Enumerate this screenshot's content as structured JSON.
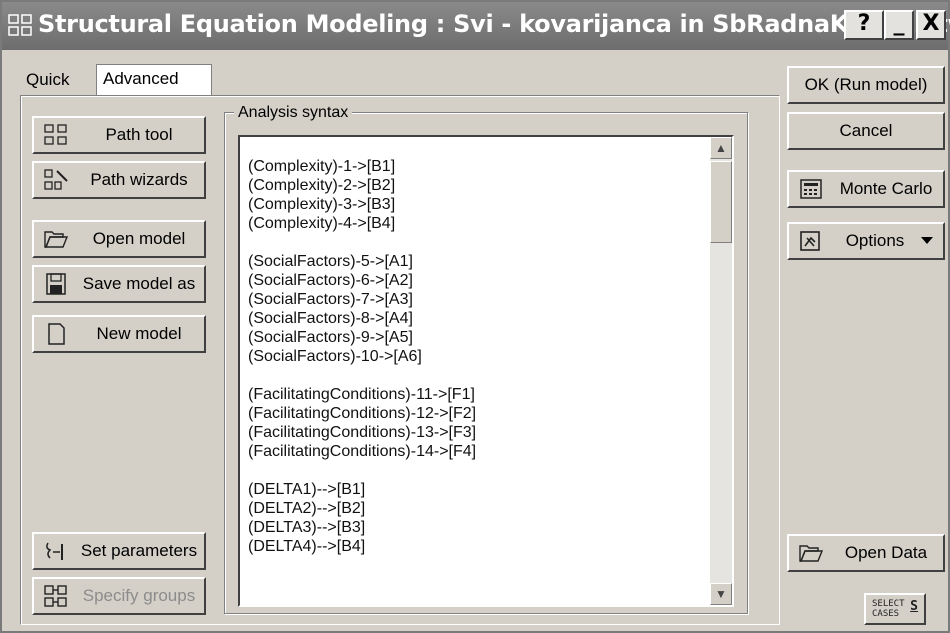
{
  "window": {
    "title": "Structural Equation Modeling : Svi - kovarijanca in SbRadnaKnjiga.stw",
    "help_glyph": "?",
    "minimize_glyph": "_",
    "close_glyph": "X"
  },
  "tabs": [
    {
      "label": "Quick"
    },
    {
      "label": "Advanced"
    }
  ],
  "left_buttons": {
    "path_tool": "Path tool",
    "path_wizards": "Path wizards",
    "open_model": "Open model",
    "save_model_as": "Save model as",
    "new_model": "New model",
    "set_parameters": "Set parameters",
    "specify_groups": "Specify groups"
  },
  "analysis": {
    "group_label": "Analysis syntax",
    "text": "(Complexity)-1->[B1]\n(Complexity)-2->[B2]\n(Complexity)-3->[B3]\n(Complexity)-4->[B4]\n\n(SocialFactors)-5->[A1]\n(SocialFactors)-6->[A2]\n(SocialFactors)-7->[A3]\n(SocialFactors)-8->[A4]\n(SocialFactors)-9->[A5]\n(SocialFactors)-10->[A6]\n\n(FacilitatingConditions)-11->[F1]\n(FacilitatingConditions)-12->[F2]\n(FacilitatingConditions)-13->[F3]\n(FacilitatingConditions)-14->[F4]\n\n(DELTA1)-->[B1]\n(DELTA2)-->[B2]\n(DELTA3)-->[B3]\n(DELTA4)-->[B4]"
  },
  "right_buttons": {
    "ok": "OK (Run model)",
    "cancel": "Cancel",
    "monte_carlo": "Monte Carlo",
    "options": "Options",
    "open_data": "Open Data",
    "select_cases": "SELECT\nCASES",
    "select_cases_glyph": "S"
  },
  "colors": {
    "face": "#d4d0c8",
    "titlebar": "#7a7a7a",
    "disabled_text": "#8c8c8c"
  },
  "icons": [
    "app-icon",
    "path-tool-icon",
    "path-wizards-icon",
    "folder-open-icon",
    "floppy-disk-icon",
    "new-document-icon",
    "set-parameters-icon",
    "specify-groups-icon",
    "calculator-icon",
    "options-icon",
    "folder-open-icon"
  ]
}
